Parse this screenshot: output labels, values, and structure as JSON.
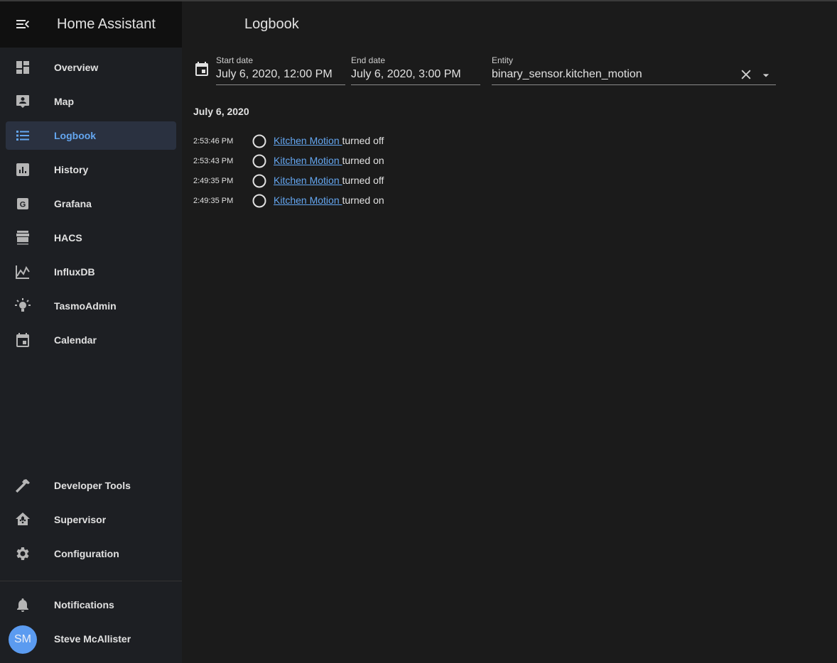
{
  "app": {
    "title": "Home Assistant"
  },
  "page": {
    "title": "Logbook"
  },
  "sidebar": {
    "items": [
      {
        "label": "Overview",
        "icon": "view-dashboard-icon"
      },
      {
        "label": "Map",
        "icon": "map-account-icon"
      },
      {
        "label": "Logbook",
        "icon": "format-list-bulleted-icon",
        "active": true
      },
      {
        "label": "History",
        "icon": "chart-box-icon"
      },
      {
        "label": "Grafana",
        "icon": "grafana-icon"
      },
      {
        "label": "HACS",
        "icon": "hacs-store-icon"
      },
      {
        "label": "InfluxDB",
        "icon": "chart-areaspline-icon"
      },
      {
        "label": "TasmoAdmin",
        "icon": "lightbulb-icon"
      },
      {
        "label": "Calendar",
        "icon": "calendar-icon"
      }
    ],
    "bottom_items": [
      {
        "label": "Developer Tools",
        "icon": "hammer-icon"
      },
      {
        "label": "Supervisor",
        "icon": "home-assistant-icon"
      },
      {
        "label": "Configuration",
        "icon": "cog-icon"
      }
    ],
    "notifications_label": "Notifications",
    "user": {
      "name": "Steve McAllister",
      "initials": "SM"
    }
  },
  "filters": {
    "start_label": "Start date",
    "start_value": "July 6, 2020, 12:00 PM",
    "end_label": "End date",
    "end_value": "July 6, 2020, 3:00 PM",
    "entity_label": "Entity",
    "entity_value": "binary_sensor.kitchen_motion"
  },
  "logbook": {
    "date_heading": "July 6, 2020",
    "entries": [
      {
        "time": "2:53:46 PM",
        "entity": "Kitchen Motion ",
        "action": "turned off"
      },
      {
        "time": "2:53:43 PM",
        "entity": "Kitchen Motion ",
        "action": "turned on"
      },
      {
        "time": "2:49:35 PM",
        "entity": "Kitchen Motion ",
        "action": "turned off"
      },
      {
        "time": "2:49:35 PM",
        "entity": "Kitchen Motion ",
        "action": "turned on"
      }
    ]
  },
  "colors": {
    "accent": "#64a6f0",
    "sidebar_bg": "#1d1f23",
    "main_bg": "#1b1b1b",
    "active_bg": "#2a3140"
  }
}
